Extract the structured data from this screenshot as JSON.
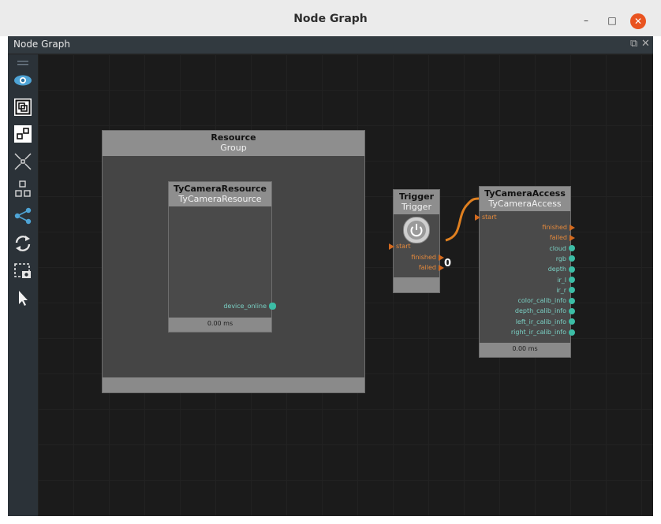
{
  "window": {
    "title": "Node Graph",
    "minimize": "–",
    "maximize": "□",
    "close": "✕"
  },
  "panel": {
    "title": "Node Graph"
  },
  "toolbar": {
    "items": [
      "menu-handle-icon",
      "eye-icon",
      "fit-view-icon",
      "layout-icon",
      "collapse-icon",
      "group-icon",
      "share-graph-icon",
      "refresh-icon",
      "screenshot-icon",
      "pointer-icon"
    ]
  },
  "nodes": {
    "resource": {
      "title": "Resource",
      "subtitle": "Group"
    },
    "tycamera_resource": {
      "title": "TyCameraResource",
      "subtitle": "TyCameraResource",
      "port_out": "device_online",
      "timing": "0.00 ms"
    },
    "trigger": {
      "title": "Trigger",
      "subtitle": "Trigger",
      "port_in": "start",
      "port_finished": "finished",
      "port_failed": "failed",
      "connection_label": "0"
    },
    "tycamera_access": {
      "title": "TyCameraAccess",
      "subtitle": "TyCameraAccess",
      "port_in": "start",
      "outputs_orange": [
        "finished",
        "failed"
      ],
      "outputs_teal": [
        "cloud",
        "rgb",
        "depth",
        "ir_l",
        "ir_r",
        "color_calib_info",
        "depth_calib_info",
        "left_ir_calib_info",
        "right_ir_calib_info"
      ],
      "timing": "0.00 ms"
    }
  },
  "colors": {
    "accent_orange": "#e08020",
    "port_teal": "#3cbda6",
    "close_button": "#e95420"
  }
}
